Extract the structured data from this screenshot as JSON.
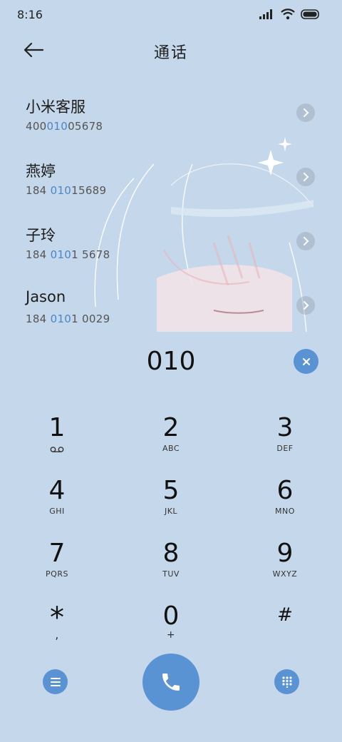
{
  "status_bar": {
    "time": "8:16"
  },
  "header": {
    "title": "通话"
  },
  "contacts": [
    {
      "name": "小米客服",
      "number_pre": "400",
      "number_hl": "010",
      "number_post": "05678"
    },
    {
      "name": "燕婷",
      "number_pre": "184 ",
      "number_hl": "010",
      "number_post": "15689"
    },
    {
      "name": "子玲",
      "number_pre": "184 ",
      "number_hl": "010",
      "number_post": "1 5678"
    },
    {
      "name": "Jason",
      "number_pre": "184 ",
      "number_hl": "010",
      "number_post": "1 0029"
    }
  ],
  "dial_input": {
    "value": "010"
  },
  "keypad": {
    "k1": {
      "digit": "1",
      "sub_icon": "voicemail-icon"
    },
    "k2": {
      "digit": "2",
      "letters": "ABC"
    },
    "k3": {
      "digit": "3",
      "letters": "DEF"
    },
    "k4": {
      "digit": "4",
      "letters": "GHI"
    },
    "k5": {
      "digit": "5",
      "letters": "JKL"
    },
    "k6": {
      "digit": "6",
      "letters": "MNO"
    },
    "k7": {
      "digit": "7",
      "letters": "PQRS"
    },
    "k8": {
      "digit": "8",
      "letters": "TUV"
    },
    "k9": {
      "digit": "9",
      "letters": "WXYZ"
    },
    "kstar": {
      "digit": "*",
      "letters": ","
    },
    "k0": {
      "digit": "0",
      "letters": "+"
    },
    "khash": {
      "digit": "#"
    }
  },
  "colors": {
    "accent": "#5a93d3",
    "background": "#c5d7ea",
    "highlight": "#4a86c8"
  },
  "icons": {
    "menu": "menu-icon",
    "call": "phone-icon",
    "keypad": "dialpad-icon",
    "clear": "close-icon",
    "back": "back-arrow-icon"
  }
}
